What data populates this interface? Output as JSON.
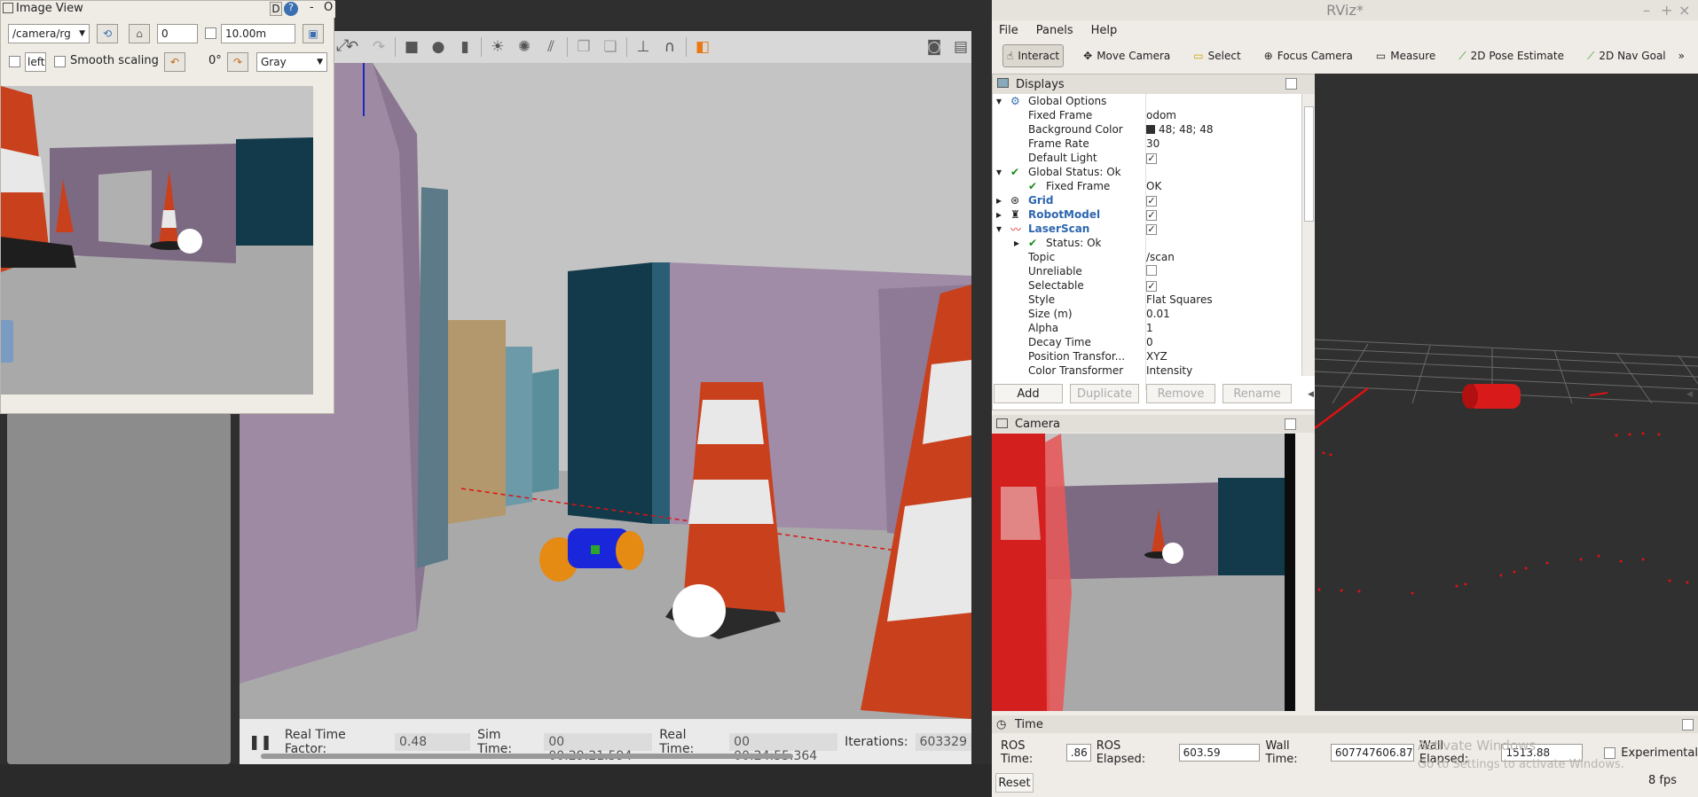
{
  "gazebo": {
    "status": {
      "pause_icon": "pause-icon",
      "rtf_label": "Real Time Factor:",
      "rtf_value": "0.48",
      "sim_label": "Sim Time:",
      "sim_value": "00 00:29:21.594",
      "real_label": "Real Time:",
      "real_value": "00 00:24:55.364",
      "iter_label": "Iterations:",
      "iter_value": "603329"
    }
  },
  "image_view": {
    "title": "Image View",
    "topic": "/camera/rg",
    "number": "0",
    "distance": "10.00m",
    "left_value": "left",
    "smooth_label": "Smooth scaling",
    "rotation": "0°",
    "color_mode": "Gray",
    "d_btn": "D",
    "o_btn": "O"
  },
  "rviz": {
    "title": "RViz*",
    "menu": [
      "File",
      "Panels",
      "Help"
    ],
    "tools": [
      "Interact",
      "Move Camera",
      "Select",
      "Focus Camera",
      "Measure",
      "2D Pose Estimate",
      "2D Nav Goal"
    ],
    "displays_title": "Displays",
    "rows": [
      {
        "name": "Global Options",
        "value": "",
        "level": 0
      },
      {
        "name": "Fixed Frame",
        "value": "odom",
        "level": 1
      },
      {
        "name": "Background Color",
        "value": "48; 48; 48",
        "level": 1
      },
      {
        "name": "Frame Rate",
        "value": "30",
        "level": 1
      },
      {
        "name": "Default Light",
        "value": "",
        "level": 1
      },
      {
        "name": "Global Status: Ok",
        "value": "",
        "level": 0
      },
      {
        "name": "Fixed Frame",
        "value": "OK",
        "level": 1
      },
      {
        "name": "Grid",
        "value": "",
        "level": 0
      },
      {
        "name": "RobotModel",
        "value": "",
        "level": 0
      },
      {
        "name": "LaserScan",
        "value": "",
        "level": 0
      },
      {
        "name": "Status: Ok",
        "value": "",
        "level": 1
      },
      {
        "name": "Topic",
        "value": "/scan",
        "level": 1
      },
      {
        "name": "Unreliable",
        "value": "",
        "level": 1
      },
      {
        "name": "Selectable",
        "value": "",
        "level": 1
      },
      {
        "name": "Style",
        "value": "Flat Squares",
        "level": 1
      },
      {
        "name": "Size (m)",
        "value": "0.01",
        "level": 1
      },
      {
        "name": "Alpha",
        "value": "1",
        "level": 1
      },
      {
        "name": "Decay Time",
        "value": "0",
        "level": 1
      },
      {
        "name": "Position Transfor...",
        "value": "XYZ",
        "level": 1
      },
      {
        "name": "Color Transformer",
        "value": "Intensity",
        "level": 1
      }
    ],
    "buttons": [
      "Add",
      "Duplicate",
      "Remove",
      "Rename"
    ],
    "camera_title": "Camera",
    "time_title": "Time",
    "ros_time_label": "ROS Time:",
    "ros_time_value": ".86",
    "ros_elapsed_label": "ROS Elapsed:",
    "ros_elapsed_value": "603.59",
    "wall_time_label": "Wall Time:",
    "wall_time_value": "607747606.87",
    "wall_elapsed_label": "Wall Elapsed:",
    "wall_elapsed_value": "1513.88",
    "experimental_label": "Experimental",
    "reset_label": "Reset",
    "fps": "8 fps",
    "watermark1": "Activate Windows",
    "watermark2": "Go to Settings to activate Windows."
  }
}
